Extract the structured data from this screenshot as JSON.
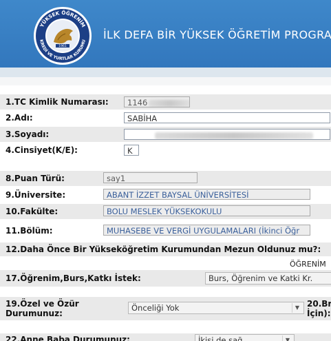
{
  "header": {
    "title": "İLK DEFA BİR YÜKSEK ÖĞRETİM PROGRA",
    "logo_text_top": "YÜKSEK ÖĞRENİM",
    "logo_text_bottom": "KREDİ VE YURTLAR KURUMU",
    "logo_year": "1961"
  },
  "form": {
    "tc": {
      "label": "1.TC Kimlik Numarası:",
      "value": "1146"
    },
    "adi": {
      "label": "2.Adı:",
      "value": "SABİHA"
    },
    "soyadi": {
      "label": "3.Soyadı:",
      "value": ""
    },
    "cinsiyet": {
      "label": "4.Cinsiyet(K/E):",
      "value": "K"
    },
    "puan": {
      "label": "8.Puan Türü:",
      "value": "say1"
    },
    "universite": {
      "label": "9.Üniversite:",
      "value": "ABANT İZZET BAYSAL ÜNİVERSİTESİ"
    },
    "fakulte": {
      "label": "10.Fakülte:",
      "value": "BOLU MESLEK YÜKSEKOKULU"
    },
    "bolum": {
      "label": "11.Bölüm:",
      "value": "MUHASEBE VE VERGİ UYGULAMALARI (İkinci Öğr"
    },
    "mezun": {
      "label": "12.Daha Önce Bir Yükseköğretim Kurumundan Mezun Oldunuz mu?:"
    },
    "ogrenim_header": "ÖĞRENİM",
    "istek": {
      "label": "17.Öğrenim,Burs,Katkı İstek:",
      "value": "Burs, Öğrenim ve Katki Kr."
    },
    "ozur": {
      "label_line1": "19.Özel ve Özür",
      "label_line2": "Durumunuz:",
      "value": "Önceliği Yok"
    },
    "field20": {
      "line1": "20.Br",
      "line2": "İçin):"
    },
    "anne_baba": {
      "label": "22.Anne Baba Durumunuz:",
      "value": "İkisi de sağ"
    }
  }
}
